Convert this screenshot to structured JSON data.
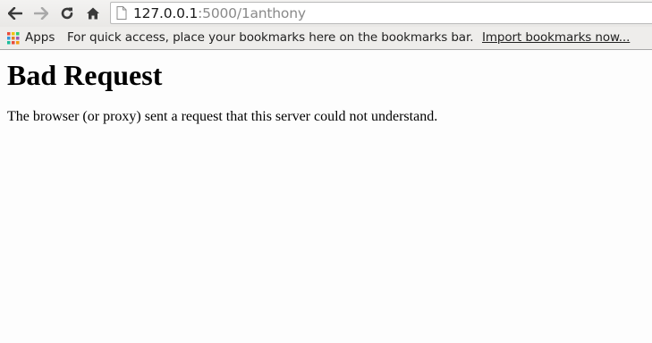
{
  "address_bar": {
    "host": "127.0.0.1",
    "path": ":5000/1anthony"
  },
  "bookmarks_bar": {
    "apps_label": "Apps",
    "hint": "For quick access, place your bookmarks here on the bookmarks bar.",
    "import_link": "Import bookmarks now..."
  },
  "page": {
    "heading": "Bad Request",
    "message": "The browser (or proxy) sent a request that this server could not understand."
  },
  "colors": {
    "apps_grid": [
      "#e74c3c",
      "#f1c40f",
      "#2ecc71",
      "#3498db",
      "#e67e22",
      "#9b59b6",
      "#1abc9c",
      "#e74c3c",
      "#f39c12"
    ]
  }
}
